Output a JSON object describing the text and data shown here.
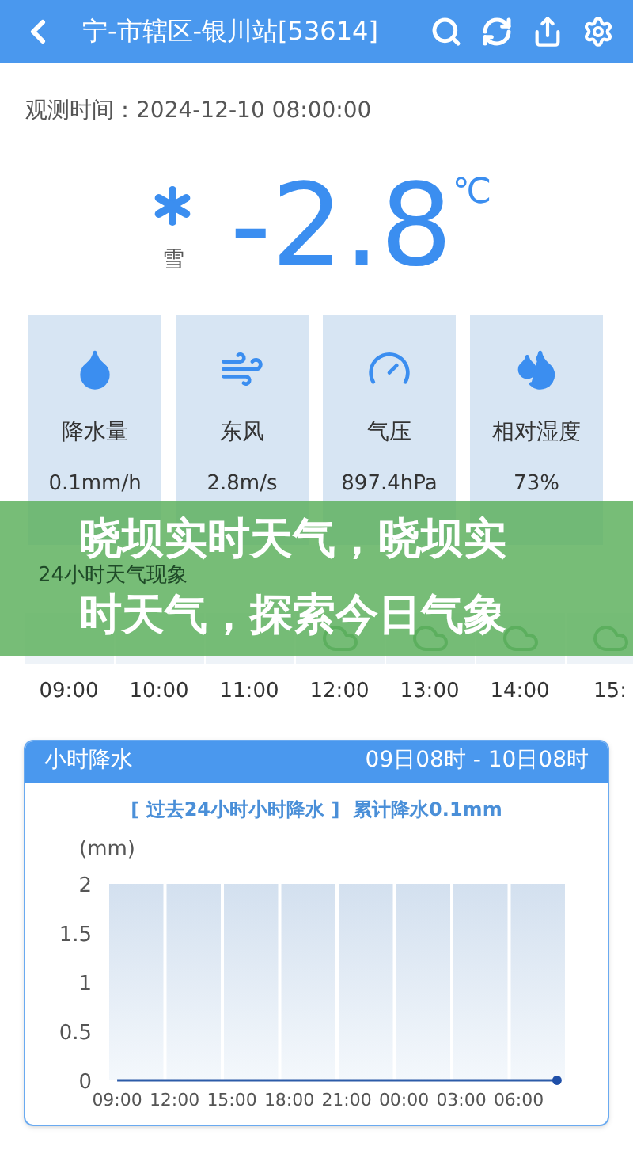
{
  "header": {
    "title": "宁-市辖区-银川站[53614]"
  },
  "observation": {
    "text": "观测时间：2024-12-10 08:00:00"
  },
  "current": {
    "weather": "雪",
    "temperature": "-2.8",
    "unit": "℃"
  },
  "stats": [
    {
      "kind": "rain",
      "label": "降水量",
      "value": "0.1mm/h"
    },
    {
      "kind": "wind",
      "label": "东风",
      "value": "2.8m/s"
    },
    {
      "kind": "pressure",
      "label": "气压",
      "value": "897.4hPa"
    },
    {
      "kind": "humidity",
      "label": "相对湿度",
      "value": "73%"
    }
  ],
  "hourly": {
    "title": "24小时天气现象",
    "hours": [
      {
        "time": "09:00"
      },
      {
        "time": "10:00"
      },
      {
        "time": "11:00"
      },
      {
        "time": "12:00",
        "kind": "cloudy"
      },
      {
        "time": "13:00",
        "kind": "cloudy"
      },
      {
        "time": "14:00",
        "kind": "cloudy"
      },
      {
        "time": "15:",
        "kind": "cloudy"
      }
    ]
  },
  "banner": {
    "lines": [
      "晓坝实时天气，晓坝实",
      "时天气，探索今日气象"
    ]
  },
  "precip": {
    "title": "小时降水",
    "range": "09日08时 - 10日08时",
    "subtitle": "[ 过去24小时小时降水 ]  累计降水0.1mm",
    "chart_data": {
      "type": "line",
      "ylabel": "(mm)",
      "categories": [
        "09:00",
        null,
        null,
        "12:00",
        null,
        null,
        "15:00",
        null,
        null,
        "18:00",
        null,
        null,
        "21:00",
        null,
        null,
        "00:00",
        null,
        null,
        "03:00",
        null,
        null,
        "06:00",
        null,
        null
      ],
      "values": [
        0,
        0,
        0,
        0,
        0,
        0,
        0,
        0,
        0,
        0,
        0,
        0,
        0,
        0,
        0,
        0,
        0,
        0,
        0,
        0,
        0,
        0,
        0,
        0
      ],
      "ylim": [
        0,
        2
      ],
      "yticks": [
        0,
        0.5,
        1,
        1.5,
        2
      ]
    }
  }
}
